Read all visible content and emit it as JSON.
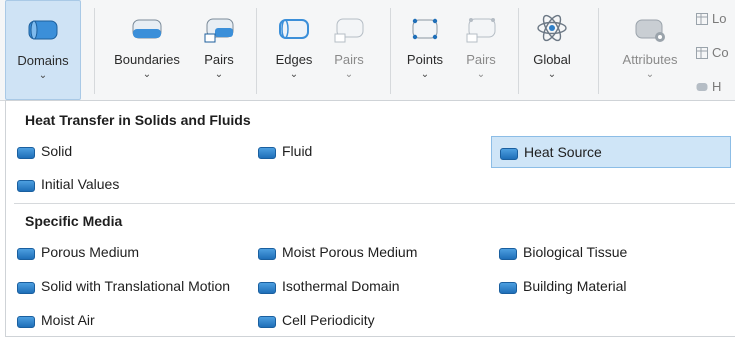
{
  "ribbon": {
    "domains": {
      "label": "Domains",
      "chev": "⌄"
    },
    "boundaries": {
      "label": "Boundaries",
      "chev": "⌄"
    },
    "pairs1": {
      "label": "Pairs",
      "chev": "⌄"
    },
    "edges": {
      "label": "Edges",
      "chev": "⌄"
    },
    "pairs2": {
      "label": "Pairs",
      "chev": "⌄"
    },
    "points": {
      "label": "Points",
      "chev": "⌄"
    },
    "pairs3": {
      "label": "Pairs",
      "chev": "⌄"
    },
    "global": {
      "label": "Global",
      "chev": "⌄"
    },
    "attributes": {
      "label": "Attributes",
      "chev": "⌄"
    },
    "side": [
      "Lo",
      "Co",
      "H"
    ]
  },
  "menu": {
    "section1": "Heat Transfer in Solids and Fluids",
    "section1_items": [
      "Solid",
      "Fluid",
      "Heat Source",
      "Initial Values"
    ],
    "section2": "Specific Media",
    "section2_items": [
      "Porous Medium",
      "Moist Porous Medium",
      "Biological Tissue",
      "Solid with Translational Motion",
      "Isothermal Domain",
      "Building Material",
      "Moist Air",
      "Cell Periodicity"
    ]
  },
  "colors": {
    "accent": "#2f7fc8",
    "selected_bg": "#cfe5f7",
    "ribbon_bg": "#f5f6f7"
  }
}
